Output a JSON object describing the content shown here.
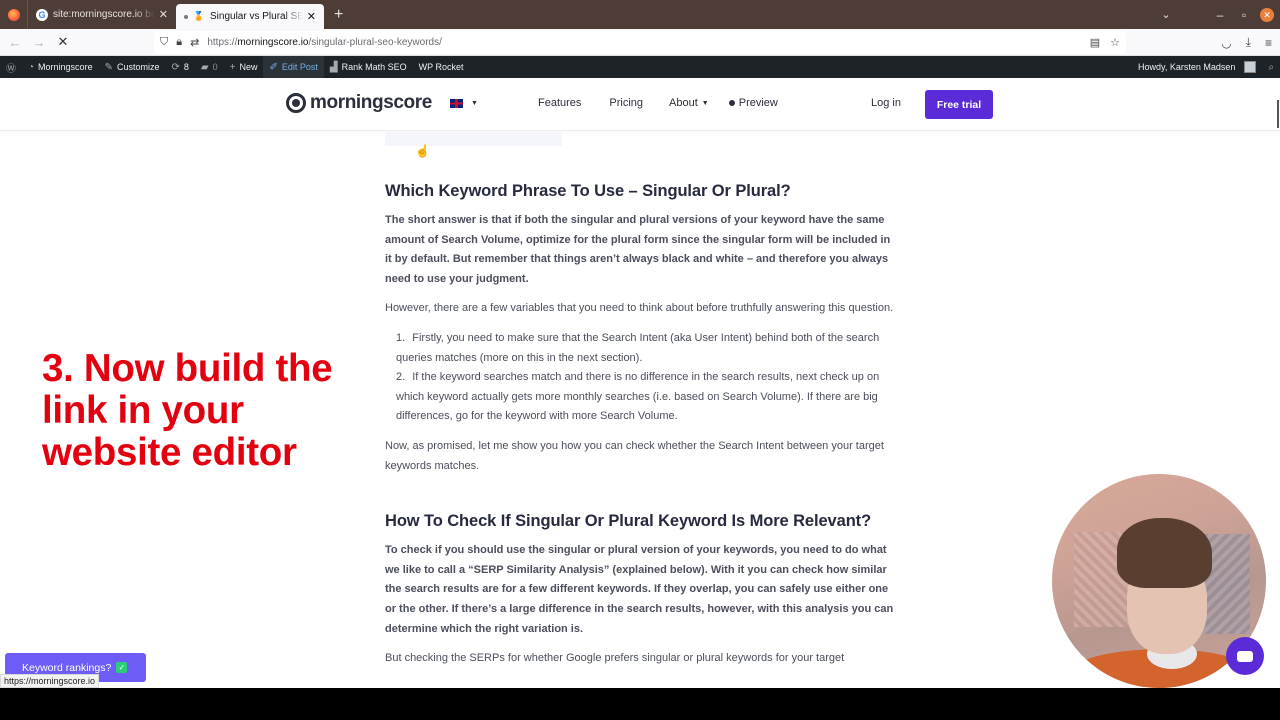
{
  "browser": {
    "tabs": [
      {
        "label": "site:morningscore.io best seo",
        "favicon": "google-icon",
        "active": false
      },
      {
        "label": "Singular vs Plural SEO Keywords",
        "favicon": "medal-icon",
        "active": true
      }
    ],
    "new_tab_label": "+",
    "url": {
      "scheme": "https://",
      "host": "morningscore.io",
      "path": "/singular-plural-seo-keywords/"
    },
    "status_url": "https://morningscore.io"
  },
  "wp_admin_bar": {
    "site_name": "Morningscore",
    "customize": "Customize",
    "updates_count": "8",
    "comments_count": "0",
    "new": "New",
    "edit_post": "Edit Post",
    "rank_math": "Rank Math SEO",
    "wp_rocket": "WP Rocket",
    "greeting": "Howdy, Karsten Madsen"
  },
  "site_header": {
    "logo_text": "morningscore",
    "nav": [
      {
        "label": "Features"
      },
      {
        "label": "Pricing"
      },
      {
        "label": "About"
      },
      {
        "label": "Preview"
      }
    ],
    "login": "Log in",
    "cta": "Free trial",
    "brand_color": "#5b2bd7"
  },
  "article": {
    "heading1": "Which Keyword Phrase To Use – Singular Or Plural?",
    "intro_bold": "The short answer is that if both the singular and plural versions of your keyword have the same amount of Search Volume, optimize for the plural form since the singular form will be included in it by default. But remember that things aren’t always black and white – and therefore you always need to use your judgment.",
    "para2": "However, there are a few variables that you need to think about before truthfully answering this question.",
    "list": [
      {
        "num": "1.",
        "text": "Firstly, you need to make sure that the Search Intent (aka User Intent) behind both of the search queries matches (more on this in the next section)."
      },
      {
        "num": "2.",
        "text": "If the keyword searches match and there is no difference in the search results, next check up on which keyword actually gets more monthly searches (i.e. based on Search Volume). If there are big differences, go for the keyword with more Search Volume."
      }
    ],
    "para3": "Now, as promised, let me show you how you can check whether the Search Intent between your target keywords matches.",
    "heading2": "How To Check If Singular Or Plural Keyword Is More Relevant?",
    "para4_bold": "To check if you should use the singular or plural version of your keywords, you need to do what we like to call a “SERP Similarity Analysis” (explained below). With it you can check how similar the search results are for a few different keywords. If they overlap, you can safely use either one or the other. If there’s a large difference in the search results, however, with this analysis you can determine which the right variation is.",
    "para5_cut": "But checking the SERPs for whether Google prefers singular or plural keywords for your target"
  },
  "overlay": {
    "caption": "3. Now build the link in your website editor",
    "color": "#e3000f"
  },
  "widgets": {
    "keyword_rankings": "Keyword rankings?",
    "check": "✓"
  }
}
